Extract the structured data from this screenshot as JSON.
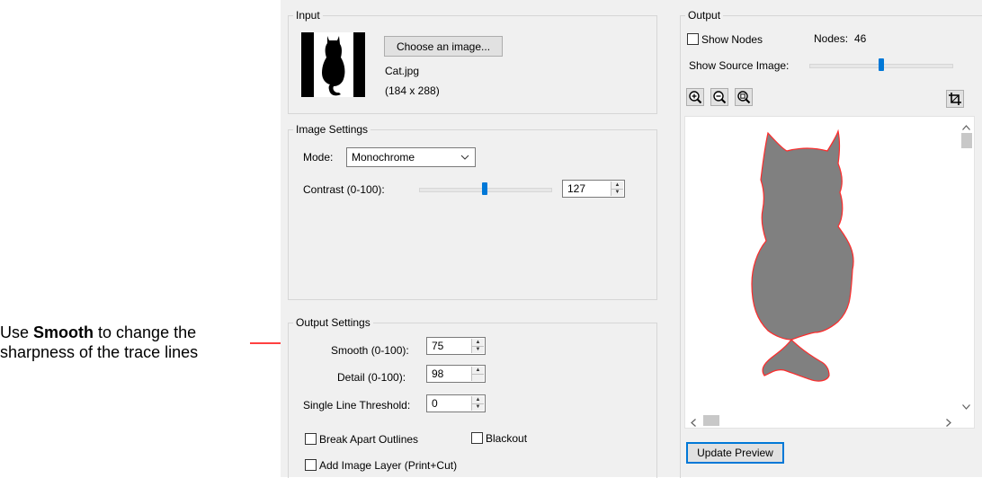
{
  "annotation": {
    "prefix": "Use ",
    "bold_word": "Smooth",
    "suffix": " to change the sharpness of the trace lines"
  },
  "input": {
    "title": "Input",
    "choose_button": "Choose an image...",
    "file_name": "Cat.jpg",
    "dimensions": "(184 x 288)"
  },
  "image_settings": {
    "title": "Image Settings",
    "mode_label": "Mode:",
    "mode_value": "Monochrome",
    "contrast_label": "Contrast (0-100):",
    "contrast_value": "127",
    "contrast_slider_level": 0.5
  },
  "output_settings": {
    "title": "Output Settings",
    "smooth_label": "Smooth (0-100):",
    "smooth_value": "75",
    "detail_label": "Detail (0-100):",
    "detail_value": "98",
    "threshold_label": "Single Line Threshold:",
    "threshold_value": "0",
    "break_apart_label": "Break Apart Outlines",
    "blackout_label": "Blackout",
    "add_image_layer_label": "Add Image Layer (Print+Cut)"
  },
  "output": {
    "title": "Output",
    "show_nodes_label": "Show Nodes",
    "nodes_label": "Nodes:",
    "nodes_value": "46",
    "show_source_label": "Show Source Image:",
    "source_slider_level": 0.48,
    "update_button": "Update Preview"
  },
  "colors": {
    "accent": "#0078d7",
    "trace_fill": "#808080",
    "trace_outline": "#ff2a2a",
    "annotation_arrow": "#ff0000"
  }
}
